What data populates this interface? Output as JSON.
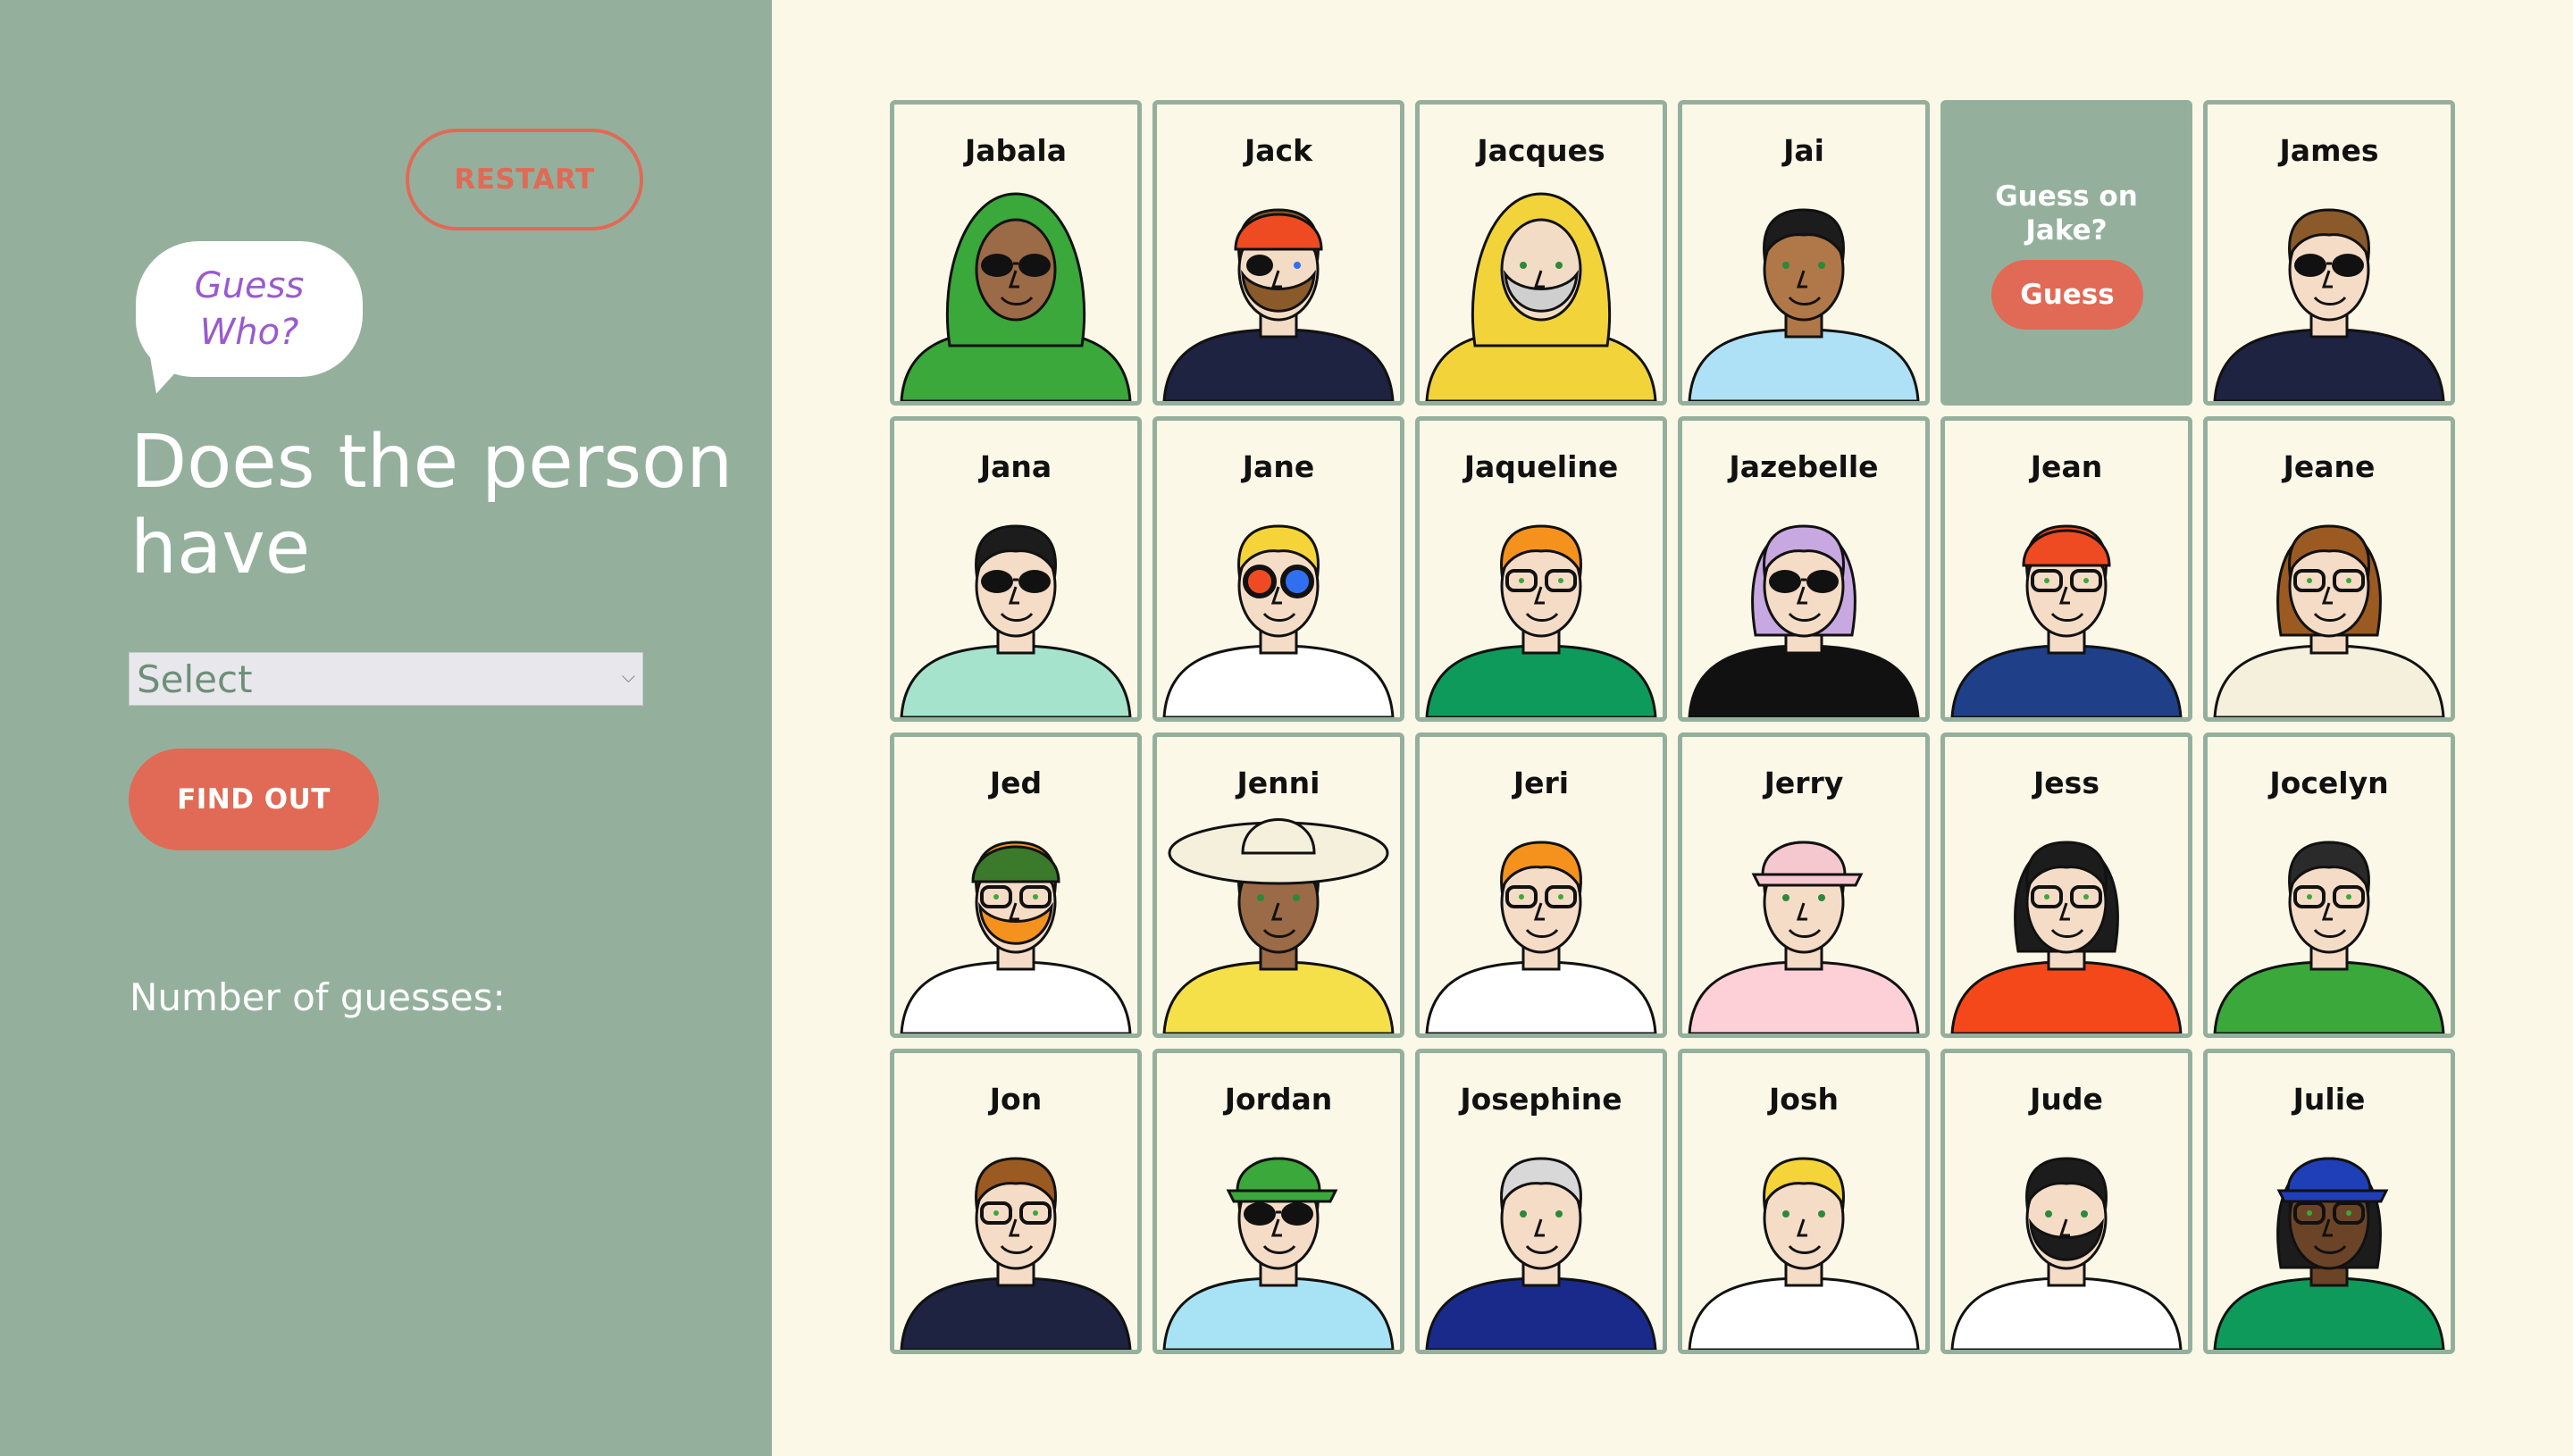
{
  "sidebar": {
    "restart_label": "RESTART",
    "logo_text": "Guess Who?",
    "question": "Does the person have",
    "select_value": "Select",
    "find_out_label": "FIND OUT",
    "guess_count_label": "Number of guesses:"
  },
  "colors": {
    "sidebar_bg": "#94b09d",
    "page_bg": "#fcf8e8",
    "accent": "#e06a55",
    "logo_text": "#9b59d0"
  },
  "guess_card": {
    "prompt": "Guess on Jake?",
    "button_label": "Guess"
  },
  "cards": [
    {
      "name": "Jabala",
      "skin": "#9b6a46",
      "hair": "#2a2a2a",
      "shirt": "#3aa83a",
      "headwear": "hijab",
      "hat": "#3aa83a",
      "eyewear": "sunglasses"
    },
    {
      "name": "Jack",
      "skin": "#f3dcc6",
      "hair": "#8a5a2b",
      "shirt": "#1d2340",
      "headwear": "bandana",
      "hat": "#ef4b23",
      "eyewear": "eyepatch",
      "beard": true
    },
    {
      "name": "Jacques",
      "skin": "#f3dcc6",
      "hair": "#cfcfcf",
      "shirt": "#f2d43a",
      "headwear": "hood",
      "hat": "#f2d43a",
      "beard": true
    },
    {
      "name": "Jai",
      "skin": "#b07848",
      "hair": "#1c1c1c",
      "shirt": "#aee1f5"
    },
    {
      "guess": true
    },
    {
      "name": "James",
      "skin": "#f5dcc6",
      "hair": "#8a5a2b",
      "shirt": "#1d2340",
      "eyewear": "sunglasses"
    },
    {
      "name": "Jana",
      "skin": "#f5dcc6",
      "hair": "#1c1c1c",
      "shirt": "#a6e3cd",
      "eyewear": "sunglasses"
    },
    {
      "name": "Jane",
      "skin": "#f5dcc6",
      "hair": "#f5d43a",
      "shirt": "#ffffff",
      "eyewear": "colorglasses"
    },
    {
      "name": "Jaqueline",
      "skin": "#f5dcc6",
      "hair": "#f5921e",
      "shirt": "#0e9a5a",
      "eyewear": "glasses"
    },
    {
      "name": "Jazebelle",
      "skin": "#f5dcc6",
      "hair": "#c8a8e0",
      "shirt": "#111111",
      "eyewear": "roundsun"
    },
    {
      "name": "Jean",
      "skin": "#f5dcc6",
      "hair": "#ef4b23",
      "shirt": "#1f3f88",
      "headwear": "beanie",
      "hat": "#ef4b23",
      "eyewear": "glasses"
    },
    {
      "name": "Jeane",
      "skin": "#f5dcc6",
      "hair": "#9a5a22",
      "shirt": "#f5f0dc",
      "eyewear": "glasses"
    },
    {
      "name": "Jed",
      "skin": "#f5dcc6",
      "hair": "#f5921e",
      "shirt": "#ffffff",
      "headwear": "beanie",
      "hat": "#3a7a2a",
      "eyewear": "glasses",
      "beard": true
    },
    {
      "name": "Jenni",
      "skin": "#9b6a46",
      "hair": "#2a2a2a",
      "shirt": "#f5e04a",
      "headwear": "sunhat",
      "hat": "#f5f0dc"
    },
    {
      "name": "Jeri",
      "skin": "#f5dcc6",
      "hair": "#f5921e",
      "shirt": "#ffffff",
      "eyewear": "glasses"
    },
    {
      "name": "Jerry",
      "skin": "#f5dcc6",
      "hair": "#f5c8d0",
      "shirt": "#fcd0d6",
      "headwear": "cap",
      "hat": "#f5c8d0"
    },
    {
      "name": "Jess",
      "skin": "#f5dcc6",
      "hair": "#1c1c1c",
      "shirt": "#f5481a",
      "eyewear": "glasses"
    },
    {
      "name": "Jocelyn",
      "skin": "#f5dcc6",
      "hair": "#2a2a2a",
      "shirt": "#3aa83a",
      "eyewear": "glasses"
    },
    {
      "name": "Jon",
      "skin": "#f5dcc6",
      "hair": "#9a5a22",
      "shirt": "#1d2340",
      "eyewear": "glasses"
    },
    {
      "name": "Jordan",
      "skin": "#f5dcc6",
      "hair": "#f5d43a",
      "shirt": "#a8e3f5",
      "headwear": "cap",
      "hat": "#3aa83a",
      "eyewear": "sunglasses"
    },
    {
      "name": "Josephine",
      "skin": "#f5dcc6",
      "hair": "#d8d8d8",
      "shirt": "#1a2a8a"
    },
    {
      "name": "Josh",
      "skin": "#f5dcc6",
      "hair": "#f5d43a",
      "shirt": "#ffffff"
    },
    {
      "name": "Jude",
      "skin": "#f5dcc6",
      "hair": "#1c1c1c",
      "shirt": "#ffffff",
      "beard": true
    },
    {
      "name": "Julie",
      "skin": "#6b4428",
      "hair": "#1c1c1c",
      "shirt": "#0e9a5a",
      "headwear": "cap",
      "hat": "#1f3fb8",
      "eyewear": "glasses"
    }
  ]
}
